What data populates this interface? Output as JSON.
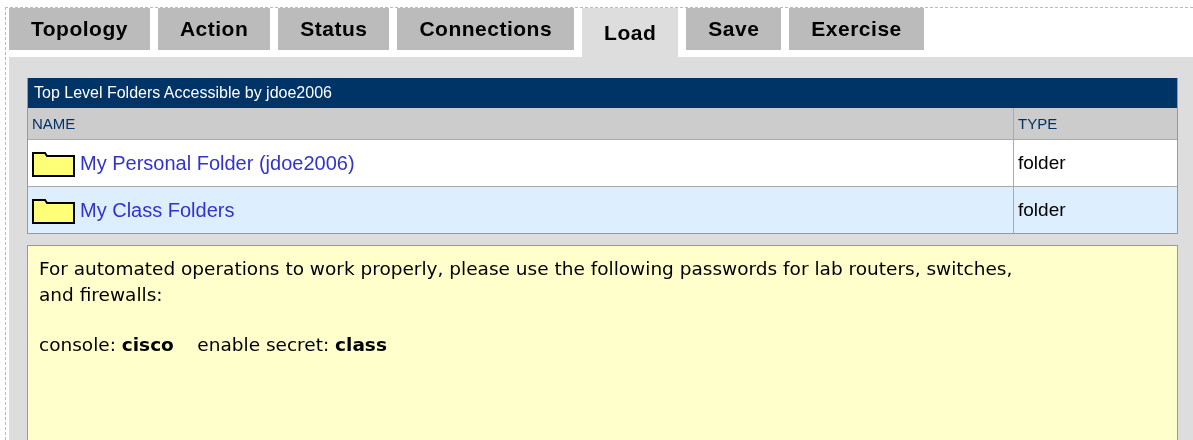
{
  "tabs": [
    {
      "label": "Topology",
      "selected": false
    },
    {
      "label": "Action",
      "selected": false
    },
    {
      "label": "Status",
      "selected": false
    },
    {
      "label": "Connections",
      "selected": false
    },
    {
      "label": "Load",
      "selected": true
    },
    {
      "label": "Save",
      "selected": false
    },
    {
      "label": "Exercise",
      "selected": false
    }
  ],
  "table": {
    "title": "Top Level Folders Accessible by jdoe2006",
    "columns": [
      "NAME",
      "TYPE"
    ],
    "rows": [
      {
        "name": "My Personal Folder (jdoe2006)",
        "type": "folder",
        "highlighted": false
      },
      {
        "name": "My Class Folders",
        "type": "folder",
        "highlighted": true
      }
    ]
  },
  "notice": {
    "paragraph": "For automated operations to work properly, please use the following passwords for lab routers, switches, and firewalls:",
    "credentials": "console: **cisco**    enable secret: **class**"
  }
}
